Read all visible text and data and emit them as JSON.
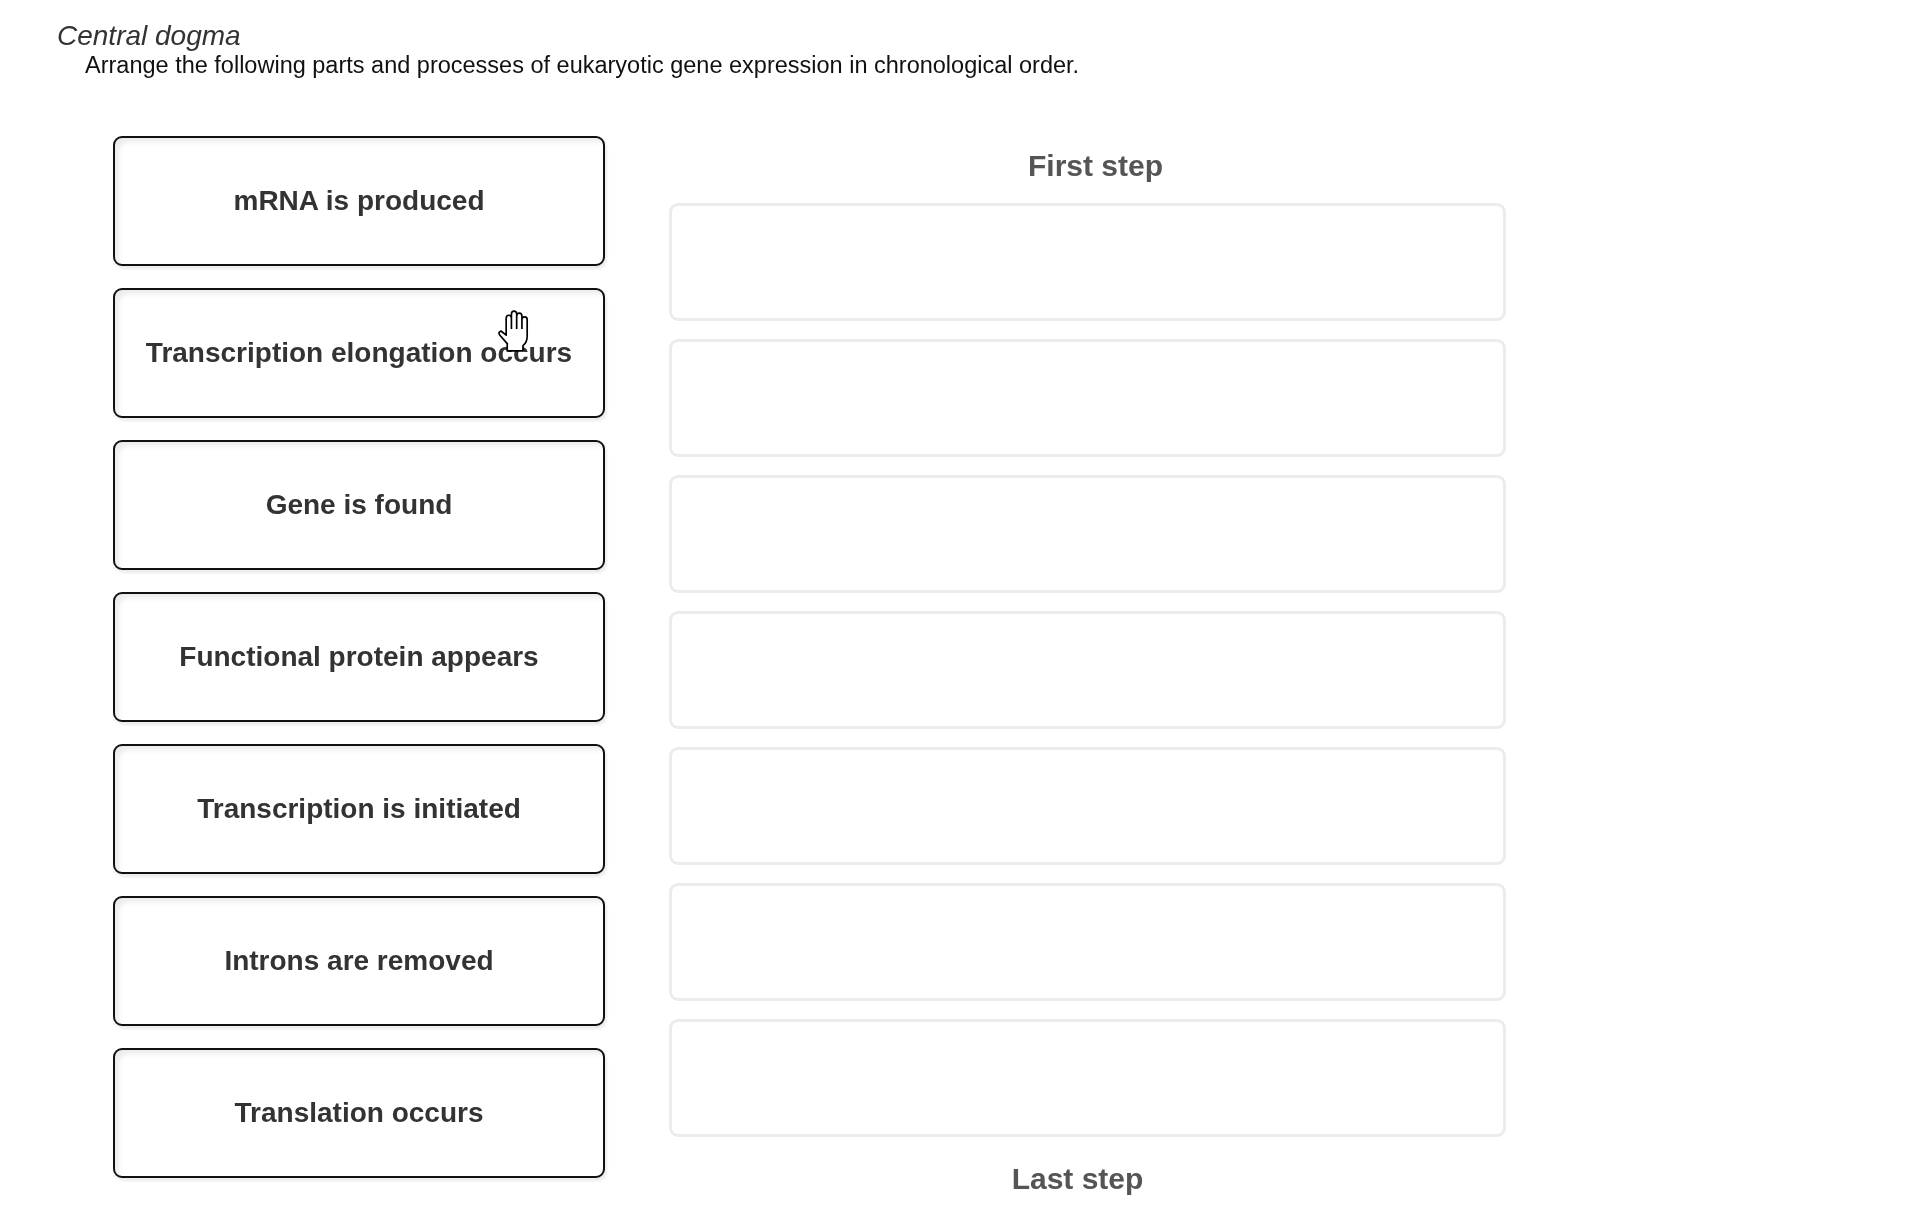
{
  "question": {
    "title": "Central dogma",
    "instruction": "Arrange the following parts and processes of eukaryotic gene expression in chronological order."
  },
  "items": [
    {
      "label": "mRNA is produced"
    },
    {
      "label": "Transcription elongation occurs"
    },
    {
      "label": "Gene is found"
    },
    {
      "label": "Functional protein appears"
    },
    {
      "label": "Transcription is initiated"
    },
    {
      "label": "Introns are removed"
    },
    {
      "label": "Translation occurs"
    }
  ],
  "ranking": {
    "top_label": "First step",
    "slots": [
      {
        "kind": "empty"
      },
      {
        "kind": "empty"
      },
      {
        "kind": "empty"
      },
      {
        "kind": "empty"
      },
      {
        "kind": "empty"
      },
      {
        "kind": "empty"
      },
      {
        "kind": "empty"
      }
    ],
    "bottom_label": "Last step"
  }
}
